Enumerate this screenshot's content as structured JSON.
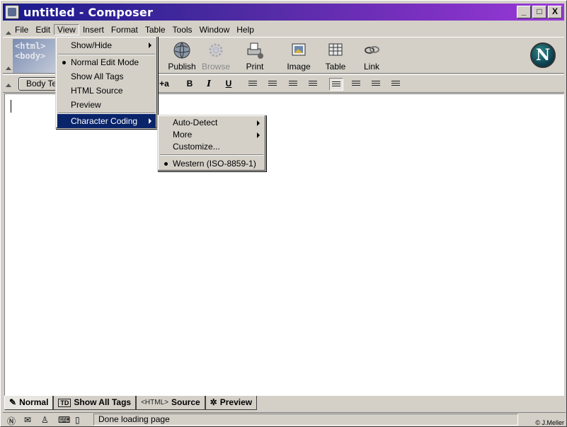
{
  "window": {
    "title": "untitled - Composer",
    "controls": [
      "_",
      "□",
      "X"
    ]
  },
  "menubar": {
    "items": [
      {
        "label": "File",
        "active": false
      },
      {
        "label": "Edit",
        "active": false
      },
      {
        "label": "View",
        "active": true
      },
      {
        "label": "Insert",
        "active": false
      },
      {
        "label": "Format",
        "active": false
      },
      {
        "label": "Table",
        "active": false
      },
      {
        "label": "Tools",
        "active": false
      },
      {
        "label": "Window",
        "active": false
      },
      {
        "label": "Help",
        "active": false
      }
    ]
  },
  "toolbar": {
    "art_text": "<html> <body>",
    "buttons": [
      {
        "label": "Publish",
        "icon": "globe-icon",
        "enabled": true
      },
      {
        "label": "Browse",
        "icon": "gear-icon",
        "enabled": false
      },
      {
        "label": "Print",
        "icon": "printer-icon",
        "enabled": true
      },
      {
        "label": "Image",
        "icon": "image-icon",
        "enabled": true
      },
      {
        "label": "Table",
        "icon": "table-icon",
        "enabled": true
      },
      {
        "label": "Link",
        "icon": "chain-link-icon",
        "enabled": true
      }
    ],
    "brand": "N"
  },
  "format_toolbar": {
    "paragraph_style": "Body Text",
    "buttons": [
      "+a",
      "B",
      "I",
      "U"
    ]
  },
  "view_menu": {
    "items": [
      {
        "label": "Show/Hide",
        "submenu": true,
        "bullet": false
      },
      {
        "label": "Normal Edit Mode",
        "submenu": false,
        "bullet": true
      },
      {
        "label": "Show All Tags",
        "submenu": false,
        "bullet": false
      },
      {
        "label": "HTML Source",
        "submenu": false,
        "bullet": false
      },
      {
        "label": "Preview",
        "submenu": false,
        "bullet": false
      },
      {
        "label": "Character Coding",
        "submenu": true,
        "bullet": false,
        "highlighted": true
      }
    ]
  },
  "coding_menu": {
    "items": [
      {
        "label": "Auto-Detect",
        "submenu": true
      },
      {
        "label": "More",
        "submenu": true
      },
      {
        "label": "Customize...",
        "submenu": false
      },
      {
        "label": "Western (ISO-8859-1)",
        "submenu": false,
        "bullet": true
      }
    ]
  },
  "tabs": [
    {
      "label": "Normal",
      "badge": "",
      "selected": true
    },
    {
      "label": "Show All Tags",
      "badge": "TD",
      "selected": false
    },
    {
      "label": "Source",
      "badge": "<HTML>",
      "selected": false
    },
    {
      "label": "Preview",
      "badge": "",
      "selected": false
    }
  ],
  "status": {
    "text": "Done loading page",
    "copyright": "© J.Meller"
  },
  "colors": {
    "title_gradient_start": "#1a1a8e",
    "title_gradient_end": "#9a3ad8",
    "menu_highlight": "#0a246a",
    "chrome": "#d4d0c8"
  }
}
